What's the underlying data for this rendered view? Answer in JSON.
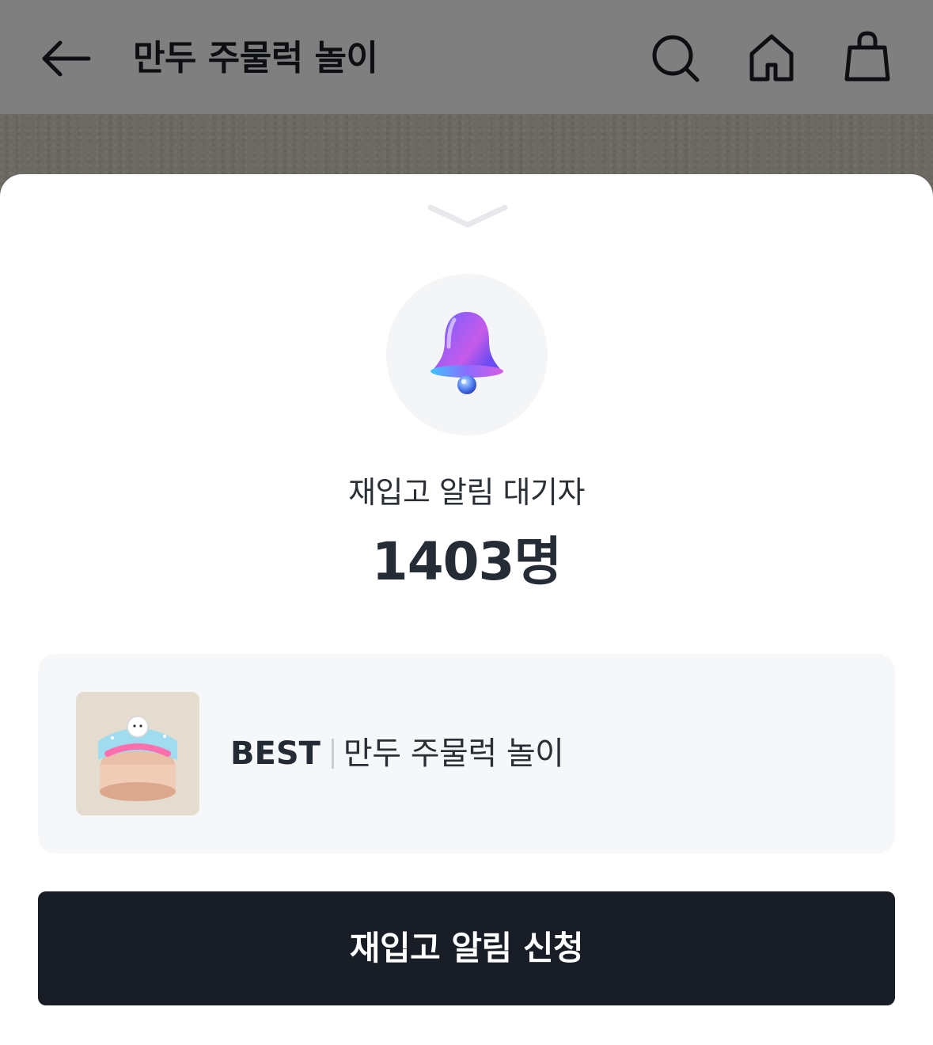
{
  "header": {
    "title": "만두 주물럭 놀이",
    "icons": {
      "back": "arrow-left-icon",
      "search": "search-icon",
      "home": "home-icon",
      "cart": "shopping-bag-icon"
    }
  },
  "sheet": {
    "handle_icon": "chevron-down-icon",
    "bell_icon": "bell-icon",
    "waiting_label": "재입고 알림 대기자",
    "waiting_count": "1403명",
    "product": {
      "badge": "BEST",
      "name": "만두 주물럭 놀이",
      "thumbnail_label": "만두주물럭놀이"
    },
    "cta_label": "재입고 알림 신청"
  },
  "colors": {
    "cta_background": "#191e26",
    "card_background": "#f6f7f9",
    "overlay": "rgba(0,0,0,0.5)",
    "text_primary": "#262c36"
  }
}
